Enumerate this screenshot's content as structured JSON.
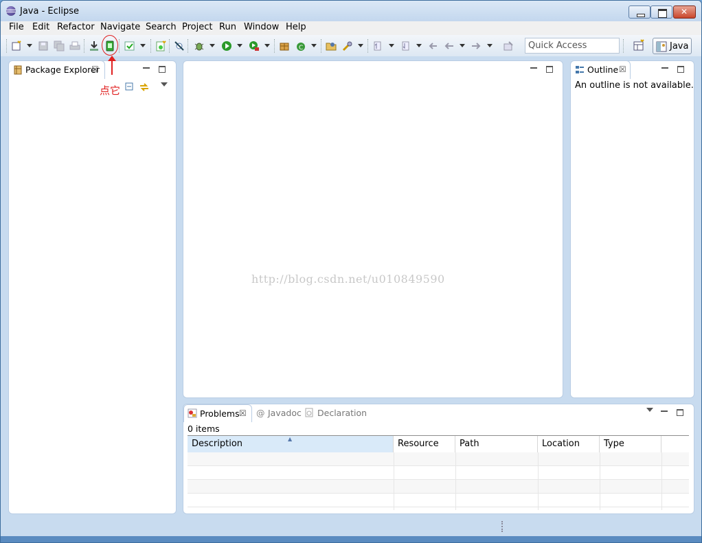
{
  "window": {
    "title": "Java - Eclipse"
  },
  "menubar": {
    "items": [
      "File",
      "Edit",
      "Refactor",
      "Navigate",
      "Search",
      "Project",
      "Run",
      "Window",
      "Help"
    ]
  },
  "toolbar": {
    "quick_access_placeholder": "Quick Access",
    "perspective_label": "Java"
  },
  "annotation": {
    "text": "点它"
  },
  "package_explorer": {
    "title": "Package Explorer"
  },
  "outline": {
    "title": "Outline",
    "message": "An outline is not available."
  },
  "bottom_panel": {
    "tabs": [
      "Problems",
      "Javadoc",
      "Declaration"
    ],
    "summary": "0 items",
    "columns": [
      "Description",
      "Resource",
      "Path",
      "Location",
      "Type"
    ]
  },
  "watermark": "http://blog.csdn.net/u010849590",
  "colors": {
    "annotation": "#e02020",
    "window_frame": "#c8dbef"
  }
}
